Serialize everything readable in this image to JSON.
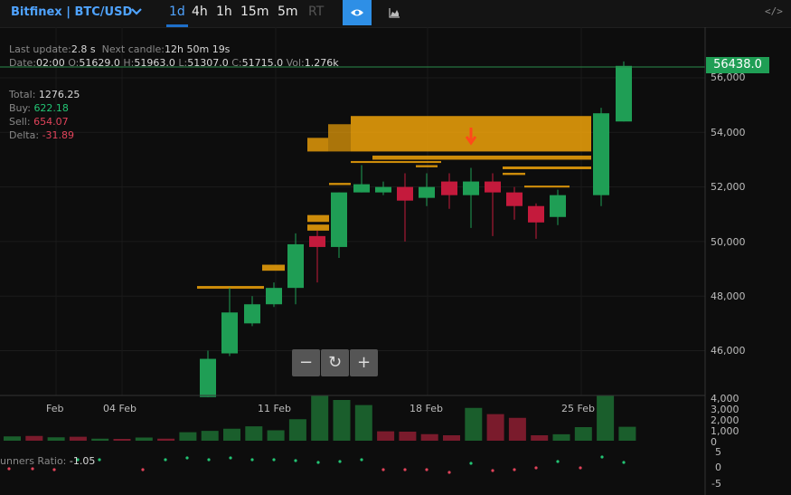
{
  "header": {
    "symbol": "Bitfinex | BTC/USD",
    "timeframes": [
      {
        "label": "1d",
        "state": "active"
      },
      {
        "label": "4h",
        "state": "normal"
      },
      {
        "label": "1h",
        "state": "normal"
      },
      {
        "label": "15m",
        "state": "normal"
      },
      {
        "label": "5m",
        "state": "normal"
      },
      {
        "label": "RT",
        "state": "disabled"
      }
    ],
    "icons": [
      "chevron-down-icon",
      "eye-icon",
      "area-chart-icon",
      "code-icon"
    ],
    "code_label": "</>",
    "accent_color": "#2e8fe6"
  },
  "info": {
    "last_update_label": "Last update:",
    "last_update_value": "2.8 s",
    "next_candle_label": "Next candle:",
    "next_candle_value": "12h 50m 19s",
    "date_label": "Date:",
    "date_value": "02:00",
    "o_label": "O:",
    "o_value": "51629.0",
    "h_label": "H:",
    "h_value": "51963.0",
    "l_label": "L:",
    "l_value": "51307.0",
    "c_label": "C:",
    "c_value": "51715.0",
    "vol_label": "Vol:",
    "vol_value": "1.276k"
  },
  "stats": {
    "total_label": "Total:",
    "total_value": "1276.25",
    "buy_label": "Buy:",
    "buy_value": "622.18",
    "sell_label": "Sell:",
    "sell_value": "654.07",
    "delta_label": "Delta:",
    "delta_value": "-31.89"
  },
  "price_tag": "56438.0",
  "controls": {
    "zoom_out": "−",
    "reset": "↻",
    "zoom_in": "+"
  },
  "ratio": {
    "label": "unners Ratio:",
    "value": "-1.05"
  },
  "colors": {
    "up": "#1f9e55",
    "down": "#c41a3c",
    "orderbook": "#f0a30a"
  },
  "chart_data": {
    "type": "candlestick",
    "title": "",
    "x_ticks": [
      "Feb",
      "04 Feb",
      "11 Feb",
      "18 Feb",
      "25 Feb"
    ],
    "y_ticks": [
      "46,000",
      "48,000",
      "50,000",
      "52,000",
      "54,000",
      "56,000"
    ],
    "volume_ticks": [
      "4,000",
      "3,000",
      "2,000",
      "1,000",
      "0"
    ],
    "ratio_ticks": [
      "5",
      "0",
      "-5"
    ],
    "ylim": [
      44300,
      58700
    ],
    "candles": [
      {
        "o": 44300,
        "h": 46000,
        "l": 44300,
        "c": 45700
      },
      {
        "o": 45900,
        "h": 48300,
        "l": 45800,
        "c": 47400
      },
      {
        "o": 47000,
        "h": 48000,
        "l": 46900,
        "c": 47700
      },
      {
        "o": 47700,
        "h": 48500,
        "l": 47600,
        "c": 48300
      },
      {
        "o": 48300,
        "h": 50300,
        "l": 47700,
        "c": 49900
      },
      {
        "o": 50200,
        "h": 50400,
        "l": 48500,
        "c": 49800
      },
      {
        "o": 49800,
        "h": 51800,
        "l": 49400,
        "c": 51800
      },
      {
        "o": 51800,
        "h": 52800,
        "l": 51800,
        "c": 52100
      },
      {
        "o": 51800,
        "h": 52200,
        "l": 51700,
        "c": 52000
      },
      {
        "o": 52000,
        "h": 52500,
        "l": 50000,
        "c": 51500
      },
      {
        "o": 51600,
        "h": 52500,
        "l": 51300,
        "c": 52000
      },
      {
        "o": 52200,
        "h": 52500,
        "l": 51200,
        "c": 51700
      },
      {
        "o": 51700,
        "h": 52700,
        "l": 50500,
        "c": 52200
      },
      {
        "o": 52200,
        "h": 52500,
        "l": 50200,
        "c": 51800
      },
      {
        "o": 51800,
        "h": 52000,
        "l": 50800,
        "c": 51300
      },
      {
        "o": 51300,
        "h": 51400,
        "l": 50100,
        "c": 50700
      },
      {
        "o": 50900,
        "h": 51900,
        "l": 50600,
        "c": 51700
      },
      {
        "o": 51700,
        "h": 54900,
        "l": 51300,
        "c": 54700
      },
      {
        "o": 54400,
        "h": 56600,
        "l": 54400,
        "c": 56438
      }
    ],
    "volume": [
      380,
      420,
      300,
      350,
      180,
      160,
      280,
      180,
      750,
      870,
      1060,
      1270,
      920,
      1900,
      4000,
      3600,
      3150,
      830,
      800,
      580,
      480,
      2900,
      2350,
      2020,
      480,
      570,
      1200,
      4000,
      1230
    ],
    "volume_up": [
      true,
      false,
      true,
      false,
      true,
      false,
      true,
      false,
      true,
      true,
      true,
      true,
      true,
      true,
      true,
      true,
      true,
      false,
      false,
      false,
      false,
      true,
      false,
      false,
      false,
      true,
      true,
      true,
      true
    ]
  }
}
